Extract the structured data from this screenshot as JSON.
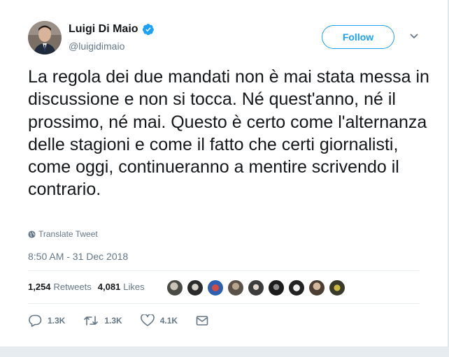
{
  "user": {
    "name": "Luigi Di Maio",
    "handle": "@luigidimaio",
    "follow_label": "Follow"
  },
  "tweet": {
    "text": "La regola dei due mandati non è mai stata messa in discussione e non si tocca. Né quest'anno, né il prossimo, né mai. Questo è certo come l'alternanza delle stagioni e come il fatto che certi giornalisti, come oggi, continueranno a mentire scrivendo il contrario.",
    "translate_label": "Translate Tweet",
    "timestamp": "8:50 AM - 31 Dec 2018"
  },
  "stats": {
    "retweets_count": "1,254",
    "retweets_label": "Retweets",
    "likes_count": "4,081",
    "likes_label": "Likes"
  },
  "actions": {
    "replies": "1.3K",
    "retweets": "1.3K",
    "likes": "4.1K"
  },
  "colors": {
    "accent": "#1da1f2",
    "secondary_text": "#657786",
    "primary_text": "#14171a"
  }
}
